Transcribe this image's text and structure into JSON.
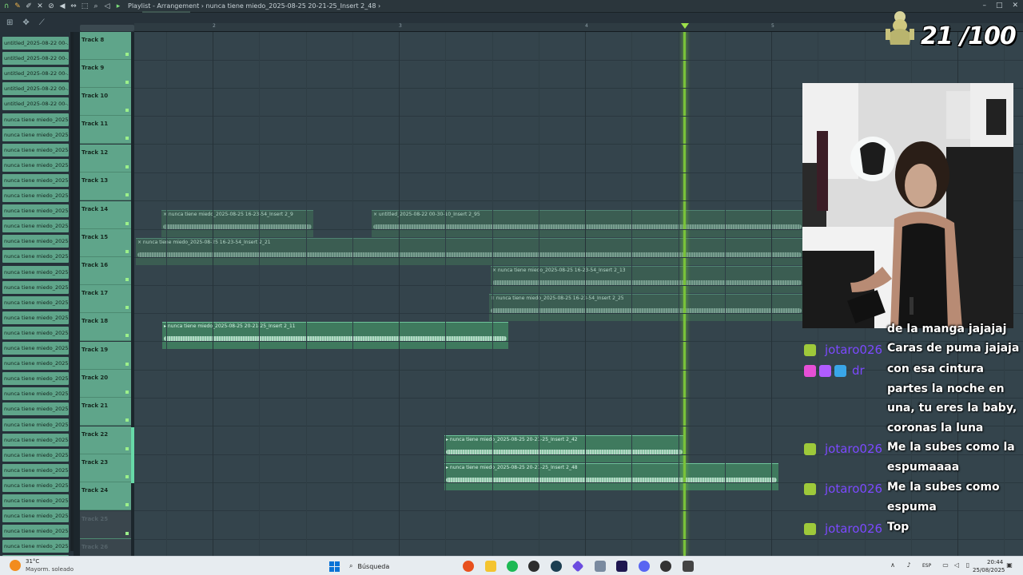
{
  "app": {
    "window_title": "Playlist - Arrangement",
    "breadcrumb_separator": "›",
    "current_clip": "nunca tiene miedo_2025-08-25 20-21-25_Insert 2_48"
  },
  "ruler": {
    "bar_numbers": [
      "2",
      "3",
      "4",
      "5"
    ],
    "scroll_label": "2 · · · · 3"
  },
  "picker": {
    "items": [
      "untitled_2025-08-22 00-...",
      "untitled_2025-08-22 00-...",
      "untitled_2025-08-22 00-...",
      "untitled_2025-08-22 00-...",
      "untitled_2025-08-22 00-...",
      "nunca tiene miedo_2025-...",
      "nunca tiene miedo_2025-...",
      "nunca tiene miedo_2025-...",
      "nunca tiene miedo_2025-...",
      "nunca tiene miedo_2025-...",
      "nunca tiene miedo_2025-...",
      "nunca tiene miedo_2025-...",
      "nunca tiene miedo_2025-...",
      "nunca tiene miedo_2025-...",
      "nunca tiene miedo_2025-...",
      "nunca tiene miedo_2025-...",
      "nunca tiene miedo_2025-...",
      "nunca tiene miedo_2025-...",
      "nunca tiene miedo_2025-...",
      "nunca tiene miedo_2025-...",
      "nunca tiene miedo_2025-...",
      "nunca tiene miedo_2025-...",
      "nunca tiene miedo_2025-...",
      "nunca tiene miedo_2025-...",
      "nunca tiene miedo_2025-...",
      "nunca tiene miedo_2025-...",
      "nunca tiene miedo_2025-...",
      "nunca tiene miedo_2025-...",
      "nunca tiene miedo_2025-...",
      "nunca tiene miedo_2025-...",
      "nunca tiene miedo_2025-...",
      "nunca tiene miedo_2025-...",
      "nunca tiene miedo_2025-...",
      "nunca tiene miedo_2025-...",
      "nunca tiene miedo_2025-..."
    ]
  },
  "tracks": [
    {
      "label": "Track 8",
      "active": true
    },
    {
      "label": "Track 9",
      "active": true
    },
    {
      "label": "Track 10",
      "active": true
    },
    {
      "label": "Track 11",
      "active": true
    },
    {
      "label": "Track 12",
      "active": true
    },
    {
      "label": "Track 13",
      "active": true
    },
    {
      "label": "Track 14",
      "active": true
    },
    {
      "label": "Track 15",
      "active": true
    },
    {
      "label": "Track 16",
      "active": true
    },
    {
      "label": "Track 17",
      "active": true
    },
    {
      "label": "Track 18",
      "active": true
    },
    {
      "label": "Track 19",
      "active": true
    },
    {
      "label": "Track 20",
      "active": true
    },
    {
      "label": "Track 21",
      "active": true
    },
    {
      "label": "Track 22",
      "active": true
    },
    {
      "label": "Track 23",
      "active": true
    },
    {
      "label": "Track 24",
      "active": true
    },
    {
      "label": "Track 25",
      "active": false
    },
    {
      "label": "Track 26",
      "active": false
    }
  ],
  "clips": [
    {
      "name": "nunca tiene miedo_2025-08-25 16-23-54_Insert 2_9",
      "track": 6,
      "bright": false
    },
    {
      "name": "untitled_2025-08-22 00-30-10_Insert 2_95",
      "track": 6,
      "bright": false
    },
    {
      "name": "nunca tiene miedo_2025-08-25 16-23-54_Insert 2_21",
      "track": 7,
      "bright": false
    },
    {
      "name": "nunca tiene miedo_2025-08-25 16-23-54_Insert 2_13",
      "track": 8,
      "bright": false
    },
    {
      "name": "nunca tiene miedo_2025-08-25 16-23-54_Insert 2_25",
      "track": 9,
      "bright": false
    },
    {
      "name": "nunca tiene miedo_2025-08-25 20-21-25_Insert 2_11",
      "track": 10,
      "bright": true
    },
    {
      "name": "nunca tiene miedo_2025-08-25 20-21-25_Insert 2_42",
      "track": 14,
      "bright": true
    },
    {
      "name": "nunca tiene miedo_2025-08-25 20-21-25_Insert 2_48",
      "track": 15,
      "bright": true
    }
  ],
  "overlay": {
    "counter_text": "21 /100"
  },
  "chat": {
    "messages": [
      {
        "user": "",
        "text": "de la manga jajajaj",
        "badges": []
      },
      {
        "user": "jotaro026",
        "text": "Caras de puma jajaja",
        "badges": [
          "x-badge"
        ]
      },
      {
        "user": "dr",
        "text": "con esa cintura partes la noche en una, tu eres la baby, coronas la luna",
        "badges": [
          "heart-badge",
          "star-badge",
          "crown-badge"
        ]
      },
      {
        "user": "jotaro026",
        "text": "Me la subes como la espumaaaa",
        "badges": [
          "x-badge"
        ]
      },
      {
        "user": "jotaro026",
        "text": "Me la subes como espuma",
        "badges": [
          "x-badge"
        ]
      },
      {
        "user": "jotaro026",
        "text": "Top",
        "badges": [
          "x-badge"
        ]
      }
    ]
  },
  "taskbar": {
    "weather_temp": "31°C",
    "weather_desc": "Mayorm. soleado",
    "search_placeholder": "Búsqueda",
    "lang": "ESP",
    "time": "20:44",
    "date": "25/08/2025"
  },
  "colors": {
    "track_green": "#5fa58a",
    "playhead": "#79c23a",
    "chat_user": "#7b49ff"
  }
}
